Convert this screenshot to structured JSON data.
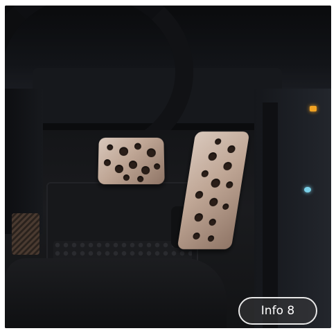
{
  "gallery": {
    "image_icon": "pedals-photo",
    "info_button_label": "Info 8"
  },
  "colors": {
    "button_border": "#e8e8e8",
    "indicator_amber": "#f2a323"
  }
}
